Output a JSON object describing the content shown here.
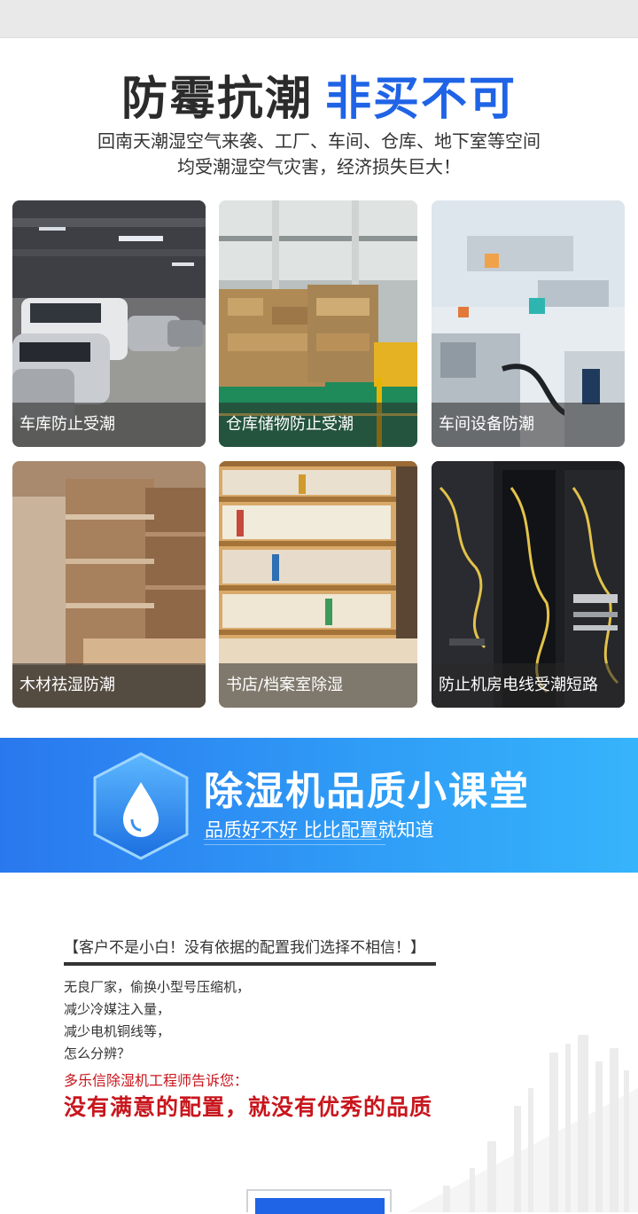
{
  "hero": {
    "title_dark": "防霉抗潮",
    "title_blue": "非买不可",
    "line1": "回南天潮湿空气来袭、工厂、车间、仓库、地下室等空间",
    "line2": "均受潮湿空气灾害，经济损失巨大！"
  },
  "tiles": [
    {
      "label": "车库防止受潮"
    },
    {
      "label": "仓库储物防止受潮"
    },
    {
      "label": "车间设备防潮"
    },
    {
      "label": "木材祛湿防潮"
    },
    {
      "label": "书店/档案室除湿"
    },
    {
      "label": "防止机房电线受潮短路"
    }
  ],
  "banner": {
    "title": "除湿机品质小课堂",
    "slogan": "品质好不好  比比配置就知道"
  },
  "article": {
    "quote": "【客户不是小白！没有依据的配置我们选择不相信！】",
    "lines": [
      "无良厂家，偷换小型号压缩机，",
      "减少冷媒注入量，",
      "减少电机铜线等，",
      "怎么分辨？"
    ],
    "engineer": "多乐信除湿机工程师告诉您：",
    "conclusion": "没有满意的配置，就没有优秀的品质"
  },
  "colors": {
    "accent_blue": "#1f63e6",
    "warning_red": "#c8161d"
  }
}
